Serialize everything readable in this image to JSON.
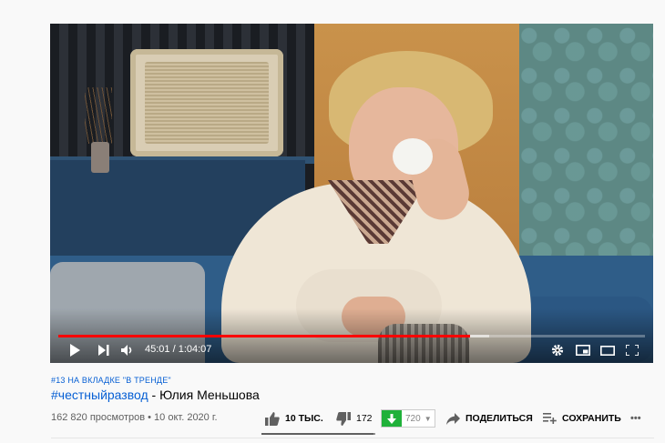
{
  "player": {
    "current_time": "45:01",
    "duration": "1:04:07",
    "time_separator": " / ",
    "progress_fraction": 0.702,
    "buffer_fraction": 0.735,
    "colors": {
      "played": "#ff0000"
    }
  },
  "video": {
    "trending": "#13 НА ВКЛАДКЕ \"В ТРЕНДЕ\"",
    "hashtag": "#честныйразвод",
    "title_rest": " - Юлия Меньшова",
    "views": "162 820 просмотров",
    "dot": " • ",
    "date": "10 окт. 2020 г."
  },
  "actions": {
    "likes": "10 ТЫС.",
    "dislikes": "172",
    "downloads": "720",
    "share": "ПОДЕЛИТЬСЯ",
    "save": "СОХРАНИТЬ",
    "more": "•••",
    "like_ratio": 0.983
  },
  "icons": {
    "play": "play-icon",
    "next": "next-icon",
    "volume": "volume-icon",
    "settings": "gear-icon",
    "miniplayer": "miniplayer-icon",
    "theater": "theater-icon",
    "fullscreen": "fullscreen-icon",
    "like": "thumbs-up-icon",
    "dislike": "thumbs-down-icon",
    "download": "download-arrow-icon",
    "share": "share-arrow-icon",
    "save": "playlist-add-icon"
  }
}
